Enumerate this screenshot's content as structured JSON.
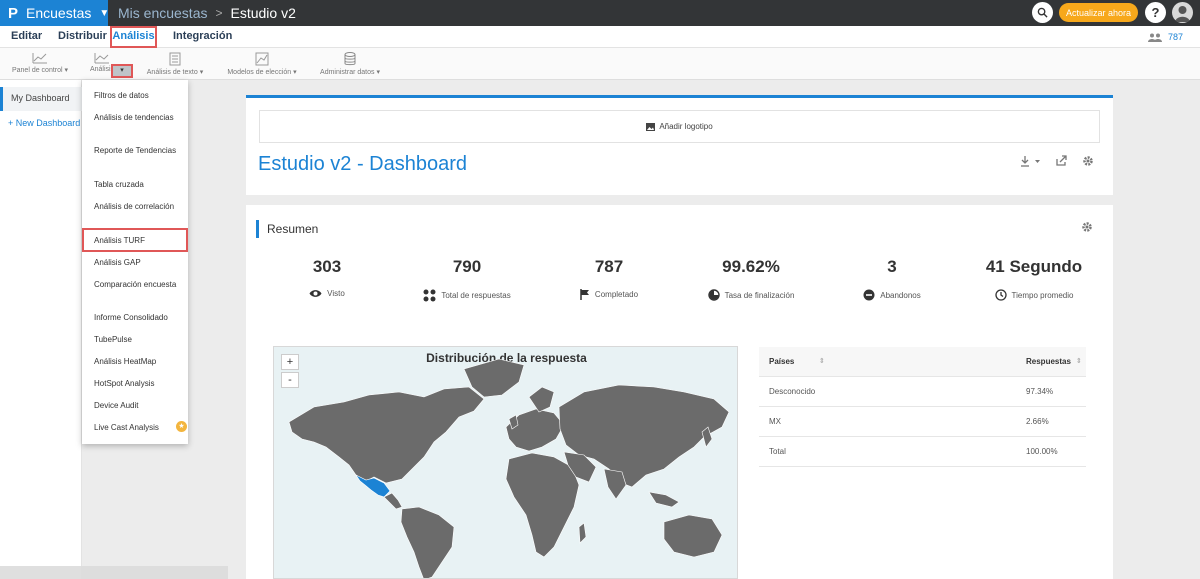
{
  "header": {
    "brand": "Encuestas",
    "breadcrumb_parent": "Mis encuestas",
    "breadcrumb_current": "Estudio v2",
    "upgrade_label": "Actualizar ahora",
    "help_label": "?"
  },
  "nav": {
    "items": [
      "Editar",
      "Distribuir",
      "Análisis",
      "Integración"
    ],
    "active": "Análisis",
    "count": "787"
  },
  "toolbar": {
    "panel": "Panel de control",
    "analisis": "Análisis",
    "texto": "Análisis de texto",
    "modelos": "Modelos de elección",
    "admin": "Administrar datos"
  },
  "sidebar": {
    "active": "My Dashboard",
    "new": "+ New Dashboard"
  },
  "dropdown": {
    "items": [
      "Filtros de datos",
      "Análisis de tendencias",
      "Reporte de Tendencias",
      "Tabla cruzada",
      "Análisis de correlación",
      "Análisis TURF",
      "Análisis GAP",
      "Comparación encuesta",
      "Informe Consolidado",
      "TubePulse",
      "Análisis HeatMap",
      "HotSpot Analysis",
      "Device Audit",
      "Live Cast Analysis"
    ],
    "highlighted": "Análisis TURF"
  },
  "dashboard": {
    "logo_label": "Añadir logotipo",
    "title": "Estudio v2 - Dashboard"
  },
  "summary": {
    "title": "Resumen",
    "stats": [
      {
        "value": "303",
        "label": "Visto",
        "icon": "eye-icon"
      },
      {
        "value": "790",
        "label": "Total de respuestas",
        "icon": "dots-icon"
      },
      {
        "value": "787",
        "label": "Completado",
        "icon": "flag-icon"
      },
      {
        "value": "99.62%",
        "label": "Tasa de finalización",
        "icon": "pie-icon"
      },
      {
        "value": "3",
        "label": "Abandonos",
        "icon": "minus-circle-icon"
      },
      {
        "value": "41 Segundo",
        "label": "Tiempo promedio",
        "icon": "clock-icon"
      }
    ]
  },
  "map": {
    "title": "Distribución de la respuesta",
    "zoom_in": "+",
    "zoom_out": "-",
    "highlight_color": "#1c83d4",
    "land_color": "#6b6b6b"
  },
  "table": {
    "headers": [
      "Países",
      "Respuestas"
    ],
    "rows": [
      {
        "country": "Desconocido",
        "value": "97.34%"
      },
      {
        "country": "MX",
        "value": "2.66%"
      },
      {
        "country": "Total",
        "value": "100.00%"
      }
    ]
  }
}
